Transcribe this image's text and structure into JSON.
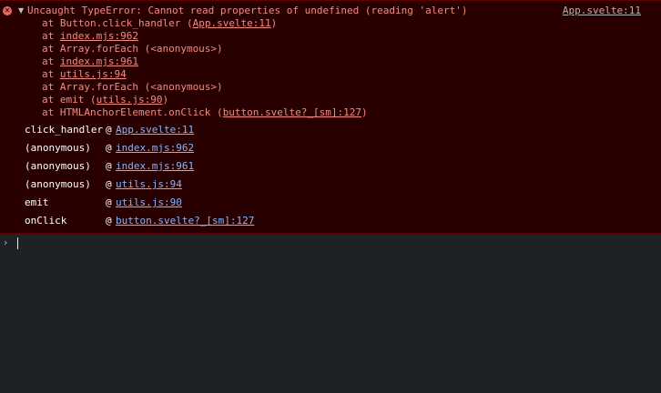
{
  "error": {
    "icon": "✕",
    "disclosure": "▼",
    "message": "Uncaught TypeError: Cannot read properties of undefined (reading 'alert')",
    "source_link": "App.svelte:11",
    "stack": [
      {
        "prefix": "at Button.click_handler (",
        "link": "App.svelte:11",
        "suffix": ")"
      },
      {
        "prefix": "at ",
        "link": "index.mjs:962",
        "suffix": ""
      },
      {
        "prefix": "at Array.forEach (<anonymous>)",
        "link": "",
        "suffix": ""
      },
      {
        "prefix": "at ",
        "link": "index.mjs:961",
        "suffix": ""
      },
      {
        "prefix": "at ",
        "link": "utils.js:94",
        "suffix": ""
      },
      {
        "prefix": "at Array.forEach (<anonymous>)",
        "link": "",
        "suffix": ""
      },
      {
        "prefix": "at emit (",
        "link": "utils.js:90",
        "suffix": ")"
      },
      {
        "prefix": "at HTMLAnchorElement.onClick (",
        "link": "button.svelte?_[sm]:127",
        "suffix": ")"
      }
    ],
    "frames": [
      {
        "fn": "click_handler",
        "at": "@",
        "url": "App.svelte:11"
      },
      {
        "fn": "(anonymous)",
        "at": "@",
        "url": "index.mjs:962"
      },
      {
        "fn": "(anonymous)",
        "at": "@",
        "url": "index.mjs:961"
      },
      {
        "fn": "(anonymous)",
        "at": "@",
        "url": "utils.js:94"
      },
      {
        "fn": "emit",
        "at": "@",
        "url": "utils.js:90"
      },
      {
        "fn": "onClick",
        "at": "@",
        "url": "button.svelte?_[sm]:127"
      }
    ]
  },
  "prompt": {
    "chevron": "›",
    "value": ""
  },
  "colors": {
    "error_bg": "#290000",
    "error_text": "#f28b82",
    "link_blue": "#8ab4f8",
    "console_bg": "#202124"
  }
}
